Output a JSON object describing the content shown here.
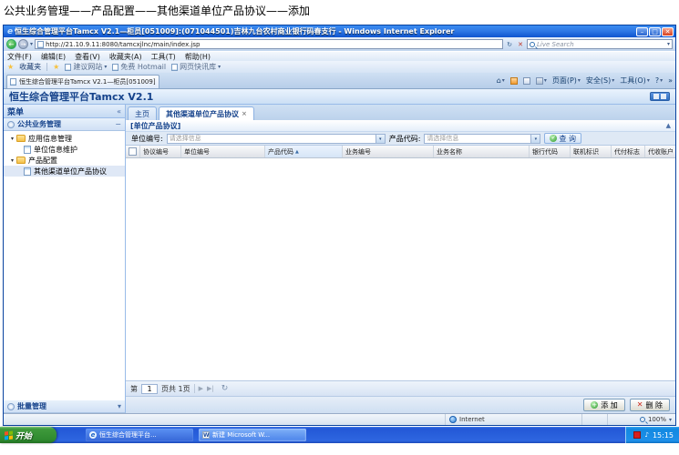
{
  "caption": "公共业务管理——产品配置——其他渠道单位产品协议——添加",
  "icons": {
    "minimize": "–",
    "maximize": "□",
    "close": "✕",
    "close_small": "×",
    "back": "←",
    "forward": "→",
    "dropdown": "▾",
    "refresh": "↻",
    "stop": "✕",
    "star": "★",
    "home": "⌂",
    "help": "?",
    "more": "»",
    "collapse_left": "«",
    "minus": "−",
    "tree_open": "▾",
    "sort_asc": "▲",
    "panel_collapse": "▲",
    "page_next": "▶",
    "page_last": "▶|",
    "page_refresh": "↻",
    "check": "✓",
    "plus": "+",
    "cross": "✕",
    "speaker": "◄)),",
    "word": "W",
    "ie": "e"
  },
  "window": {
    "title": "恒生综合管理平台Tamcx V2.1—柜员[051009]:(071044501)吉林九台农村商业银行码春支行 - Windows Internet Explorer",
    "address_url": "http://21.10.9.11:8080/tamcxjlnc/main/index.jsp",
    "search_text": "Live Search",
    "menu_items": [
      "文件(F)",
      "编辑(E)",
      "查看(V)",
      "收藏夹(A)",
      "工具(T)",
      "帮助(H)"
    ],
    "favorites_button": "收藏夹",
    "favorites_items": [
      "建议网站",
      "免费 Hotmail",
      "网页快讯库"
    ],
    "tab_title": "恒生综合管理平台Tamcx V2.1—柜员[051009]",
    "commandbar": {
      "page": "页面(P)",
      "safety": "安全(S)",
      "tools": "工具(O)"
    },
    "statusbar": {
      "zone": "Internet",
      "zoom": "100%"
    }
  },
  "portal": {
    "header_title": "恒生综合管理平台Tamcx V2.1",
    "sidebar": {
      "menu_title": "菜单",
      "group_top": "公共业务管理",
      "group_bottom": "批量管理",
      "tree": [
        {
          "label": "应用信息管理"
        },
        {
          "label": "单位信息维护"
        },
        {
          "label": "产品配置"
        },
        {
          "label": "其他渠道单位产品协议"
        }
      ]
    },
    "tabs": {
      "home": "主页",
      "active": "其他渠道单位产品协议"
    },
    "panel_title": "[单位产品协议]",
    "form": {
      "unit_label": "单位编号:",
      "unit_placeholder": "请选择信息",
      "product_label": "产品代码:",
      "product_placeholder": "请选择信息",
      "query_button": "查 询"
    },
    "grid": {
      "columns": [
        "协议编号",
        "单位编号",
        "产品代码",
        "业务编号",
        "业务名称",
        "银行代码",
        "联机标识",
        "代付标志",
        "代收账户"
      ]
    },
    "pagination": {
      "before": "第",
      "page_value": "1",
      "after": "页共 1页"
    },
    "footer": {
      "add": "添 加",
      "delete": "删 除"
    }
  },
  "taskbar": {
    "start": "开始",
    "task1": "恒生综合管理平台...",
    "task2": "新建 Microsoft W...",
    "time": "15:15"
  }
}
